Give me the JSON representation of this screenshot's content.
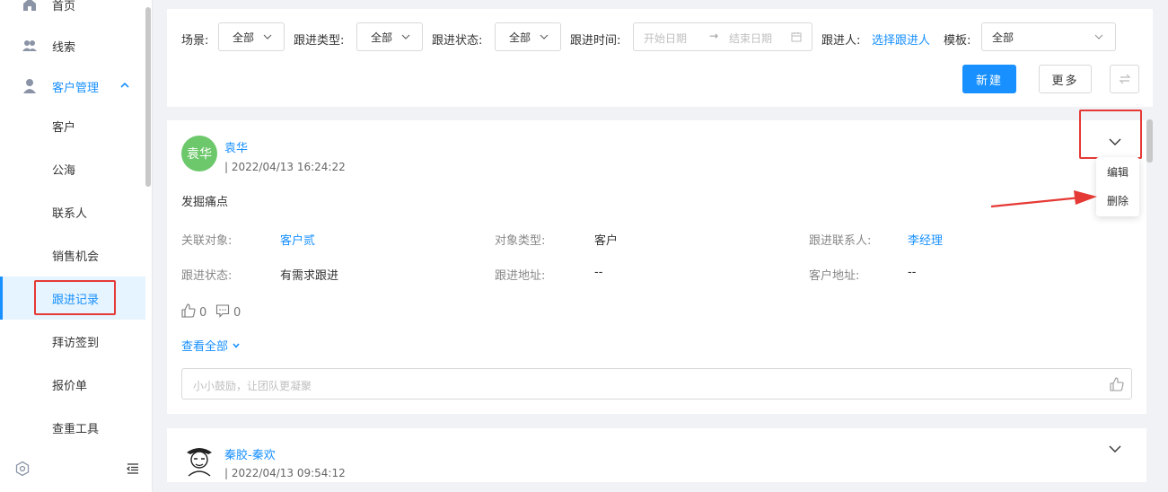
{
  "sidebar": {
    "items": [
      {
        "label": "首页",
        "icon": "home-icon"
      },
      {
        "label": "线索",
        "icon": "users-icon"
      },
      {
        "label": "客户管理",
        "icon": "user-icon"
      }
    ],
    "sub_items": [
      {
        "label": "客户"
      },
      {
        "label": "公海"
      },
      {
        "label": "联系人"
      },
      {
        "label": "销售机会"
      },
      {
        "label": "跟进记录"
      },
      {
        "label": "拜访签到"
      },
      {
        "label": "报价单"
      },
      {
        "label": "查重工具"
      }
    ],
    "settings_icon": "gear-icon",
    "collapse_icon": "collapse-menu-icon"
  },
  "filters": {
    "scene_label": "场景:",
    "scene_value": "全部",
    "type_label": "跟进类型:",
    "type_value": "全部",
    "status_label": "跟进状态:",
    "status_value": "全部",
    "time_label": "跟进时间:",
    "start_placeholder": "开始日期",
    "end_placeholder": "结束日期",
    "follower_label": "跟进人:",
    "follower_link": "选择跟进人",
    "template_label": "模板:",
    "template_value": "全部",
    "new_button": "新建",
    "more_button": "更多"
  },
  "records": [
    {
      "avatar_text": "袁华",
      "avatar_color": "#6cc86a",
      "name": "袁华",
      "time": "| 2022/04/13 16:24:22",
      "content": "发掘痛点",
      "fields": {
        "related_label": "关联对象:",
        "related_value": "客户贰",
        "object_type_label": "对象类型:",
        "object_type_value": "客户",
        "contact_label": "跟进联系人:",
        "contact_value": "李经理",
        "status_label": "跟进状态:",
        "status_value": "有需求跟进",
        "address_label": "跟进地址:",
        "address_value": "--",
        "customer_address_label": "客户地址:",
        "customer_address_value": "--"
      },
      "likes": "0",
      "comments": "0",
      "view_all": "查看全部",
      "comment_placeholder": "小小鼓励，让团队更凝聚"
    },
    {
      "name": "秦胶-秦欢",
      "time": "| 2022/04/13 09:54:12"
    }
  ],
  "dropdown": {
    "edit": "编辑",
    "delete": "删除"
  },
  "colors": {
    "primary": "#1890ff",
    "highlight": "#e53935"
  }
}
